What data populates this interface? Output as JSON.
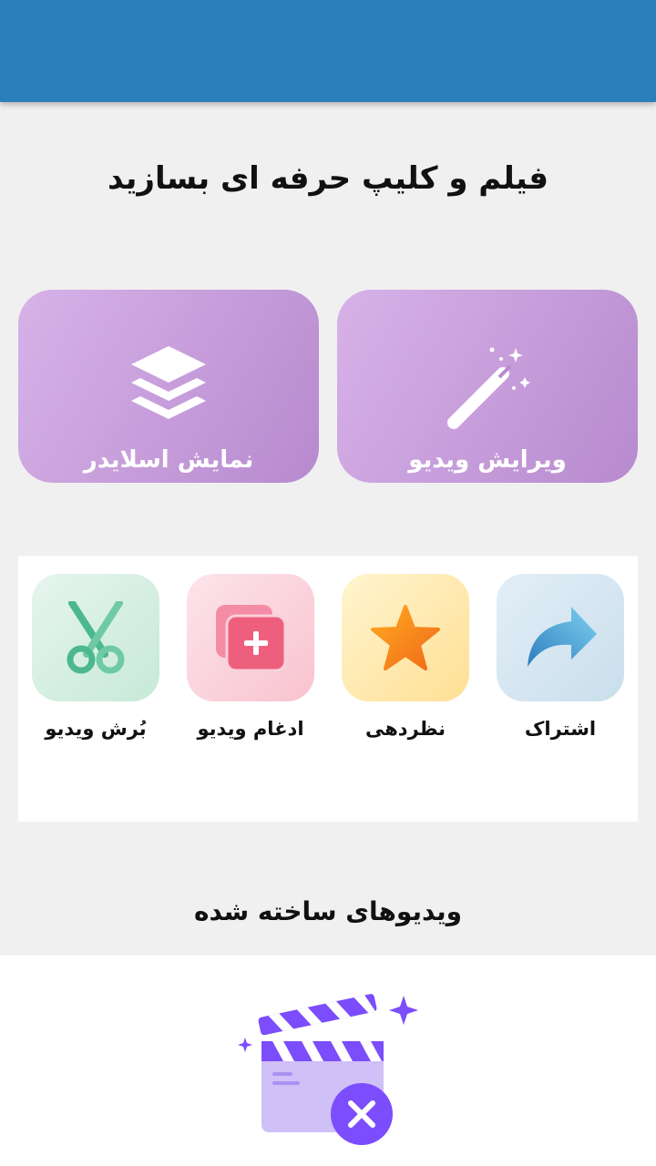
{
  "app_bar": {
    "title": ""
  },
  "headline": "فیلم و کلیپ حرفه ای بسازید",
  "main_actions": [
    {
      "label": "ویرایش ویدیو",
      "icon": "magic-wand-icon"
    },
    {
      "label": "نمایش اسلایدر",
      "icon": "layers-icon"
    }
  ],
  "tools": [
    {
      "label": "اشتراک",
      "icon": "share-arrow-icon"
    },
    {
      "label": "نظردهی",
      "icon": "star-icon"
    },
    {
      "label": "ادغام ویدیو",
      "icon": "merge-add-icon"
    },
    {
      "label": "بُرش ویدیو",
      "icon": "scissors-icon"
    }
  ],
  "videos_section": {
    "title": "ویدیوهای ساخته شده",
    "empty_icon": "clapperboard-empty-icon"
  },
  "colors": {
    "app_bar": "#2a7fb8",
    "card_gradient_start": "#d7b2e8",
    "card_gradient_end": "#b78ace",
    "clapper_purple": "#7b4dfc"
  }
}
